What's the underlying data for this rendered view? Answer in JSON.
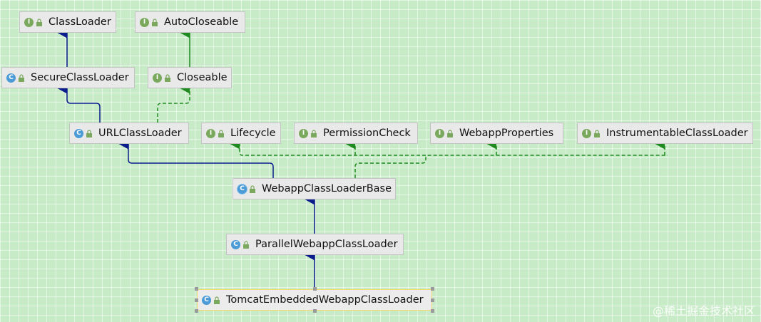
{
  "nodes": {
    "classloader": {
      "kind": "interface",
      "badge": "I",
      "label": "ClassLoader"
    },
    "autocloseable": {
      "kind": "interface",
      "badge": "I",
      "label": "AutoCloseable"
    },
    "secureclassloader": {
      "kind": "class",
      "badge": "C",
      "label": "SecureClassLoader"
    },
    "closeable": {
      "kind": "interface",
      "badge": "I",
      "label": "Closeable"
    },
    "urlclassloader": {
      "kind": "class",
      "badge": "C",
      "label": "URLClassLoader"
    },
    "lifecycle": {
      "kind": "interface",
      "badge": "I",
      "label": "Lifecycle"
    },
    "permissioncheck": {
      "kind": "interface",
      "badge": "I",
      "label": "PermissionCheck"
    },
    "webappproperties": {
      "kind": "interface",
      "badge": "I",
      "label": "WebappProperties"
    },
    "instrumentableclassloader": {
      "kind": "interface",
      "badge": "I",
      "label": "InstrumentableClassLoader"
    },
    "webappclassloaderbase": {
      "kind": "abstract-class",
      "badge": "C",
      "label": "WebappClassLoaderBase"
    },
    "parallelwebappclassloader": {
      "kind": "class",
      "badge": "C",
      "label": "ParallelWebappClassLoader"
    },
    "tomcatembeddedwebappclassloader": {
      "kind": "class",
      "badge": "C",
      "label": "TomcatEmbeddedWebappClassLoader",
      "selected": true
    }
  },
  "edges": [
    {
      "from": "SecureClassLoader",
      "to": "ClassLoader",
      "type": "extends"
    },
    {
      "from": "Closeable",
      "to": "AutoCloseable",
      "type": "extends-interface"
    },
    {
      "from": "URLClassLoader",
      "to": "SecureClassLoader",
      "type": "extends"
    },
    {
      "from": "URLClassLoader",
      "to": "Closeable",
      "type": "implements"
    },
    {
      "from": "WebappClassLoaderBase",
      "to": "URLClassLoader",
      "type": "extends"
    },
    {
      "from": "WebappClassLoaderBase",
      "to": "Lifecycle",
      "type": "implements"
    },
    {
      "from": "WebappClassLoaderBase",
      "to": "PermissionCheck",
      "type": "implements"
    },
    {
      "from": "WebappClassLoaderBase",
      "to": "WebappProperties",
      "type": "implements"
    },
    {
      "from": "WebappClassLoaderBase",
      "to": "InstrumentableClassLoader",
      "type": "implements"
    },
    {
      "from": "ParallelWebappClassLoader",
      "to": "WebappClassLoaderBase",
      "type": "extends"
    },
    {
      "from": "TomcatEmbeddedWebappClassLoader",
      "to": "ParallelWebappClassLoader",
      "type": "extends"
    }
  ],
  "colors": {
    "background": "#c7ebc7",
    "extends_edge": "#0b1c8c",
    "implements_edge": "#1f8a1f",
    "interface_badge": "#7aa85c",
    "class_badge": "#4b9bd6",
    "selection": "#f5d76e"
  },
  "watermark": "@稀土掘金技术社区"
}
